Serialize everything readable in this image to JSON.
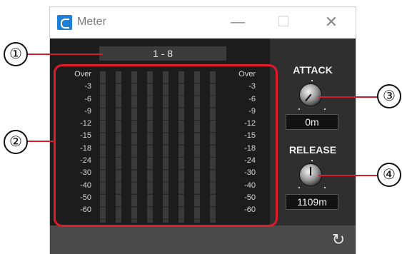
{
  "window": {
    "title": "Meter",
    "controls": {
      "minimize": "—",
      "maximize": "☐",
      "close": "✕"
    }
  },
  "meter": {
    "header": "1 - 8",
    "scale": [
      "Over",
      "-3",
      "-6",
      "-9",
      "-12",
      "-15",
      "-18",
      "-24",
      "-30",
      "-40",
      "-50",
      "-60"
    ],
    "channels": 8
  },
  "attack": {
    "label": "ATTACK",
    "value": "0m"
  },
  "release": {
    "label": "RELEASE",
    "value": "1109m"
  },
  "callouts": [
    "①",
    "②",
    "③",
    "④"
  ],
  "colors": {
    "callout_line": "#d51e2d",
    "frame": "#e01b2a",
    "panel": "#1c1c1c"
  },
  "icons": {
    "refresh": "refresh-icon",
    "app": "app-icon"
  }
}
